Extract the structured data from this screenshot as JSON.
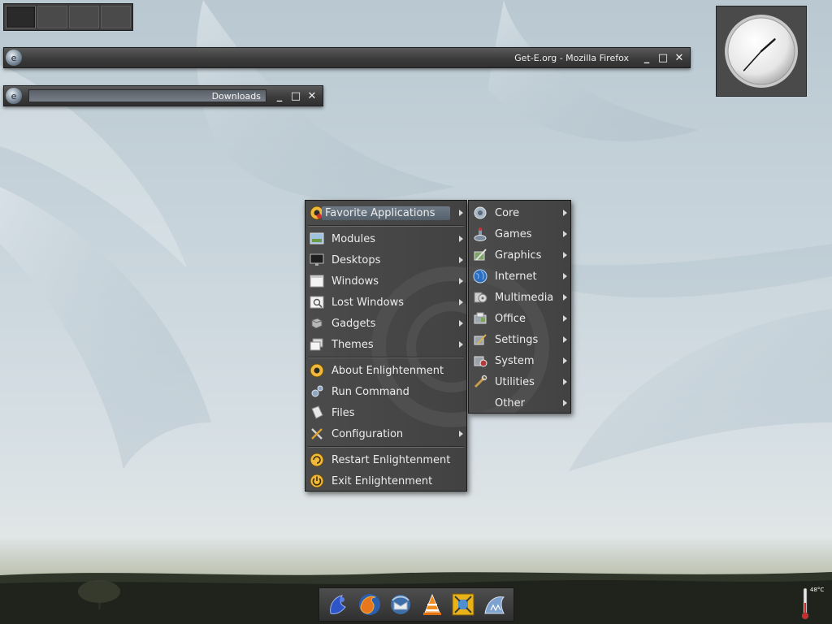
{
  "windows": [
    {
      "title": "Get-E.org - Mozilla Firefox"
    },
    {
      "title": "Downloads"
    }
  ],
  "window_buttons": {
    "minimize": "_",
    "maximize": "□",
    "close": "✕"
  },
  "main_menu": {
    "items": [
      {
        "label": "Favorite Applications",
        "icon": "favorites-icon",
        "submenu": true,
        "selected": true
      },
      {
        "label": "Modules",
        "icon": "modules-icon",
        "submenu": true
      },
      {
        "label": "Desktops",
        "icon": "desktops-icon",
        "submenu": true
      },
      {
        "label": "Windows",
        "icon": "windows-icon",
        "submenu": true
      },
      {
        "label": "Lost Windows",
        "icon": "lost-windows-icon",
        "submenu": true
      },
      {
        "label": "Gadgets",
        "icon": "gadgets-icon",
        "submenu": true
      },
      {
        "label": "Themes",
        "icon": "themes-icon",
        "submenu": true
      },
      {
        "label": "About Enlightenment",
        "icon": "about-icon",
        "submenu": false
      },
      {
        "label": "Run Command",
        "icon": "run-command-icon",
        "submenu": false
      },
      {
        "label": "Files",
        "icon": "files-icon",
        "submenu": false
      },
      {
        "label": "Configuration",
        "icon": "configuration-icon",
        "submenu": true
      },
      {
        "label": "Restart Enlightenment",
        "icon": "restart-icon",
        "submenu": false
      },
      {
        "label": "Exit Enlightenment",
        "icon": "exit-icon",
        "submenu": false
      }
    ]
  },
  "submenu": {
    "items": [
      {
        "label": "Core",
        "icon": "core-icon"
      },
      {
        "label": "Games",
        "icon": "games-icon"
      },
      {
        "label": "Graphics",
        "icon": "graphics-icon"
      },
      {
        "label": "Internet",
        "icon": "internet-icon"
      },
      {
        "label": "Multimedia",
        "icon": "multimedia-icon"
      },
      {
        "label": "Office",
        "icon": "office-icon"
      },
      {
        "label": "Settings",
        "icon": "settings-icon"
      },
      {
        "label": "System",
        "icon": "system-icon"
      },
      {
        "label": "Utilities",
        "icon": "utilities-icon"
      },
      {
        "label": "Other",
        "icon": ""
      }
    ]
  },
  "clock": {
    "hour": 1,
    "minute": 37
  },
  "shelf": {
    "apps": [
      "enlightenment-icon",
      "firefox-icon",
      "thunderbird-icon",
      "vlc-icon",
      "workspace-icon",
      "terminal-shark-icon"
    ]
  },
  "temperature": {
    "label": "48°C"
  },
  "colors": {
    "menu_bg": "#454545",
    "highlight": "#5f6b77",
    "desktop": "#c3d0d8"
  }
}
